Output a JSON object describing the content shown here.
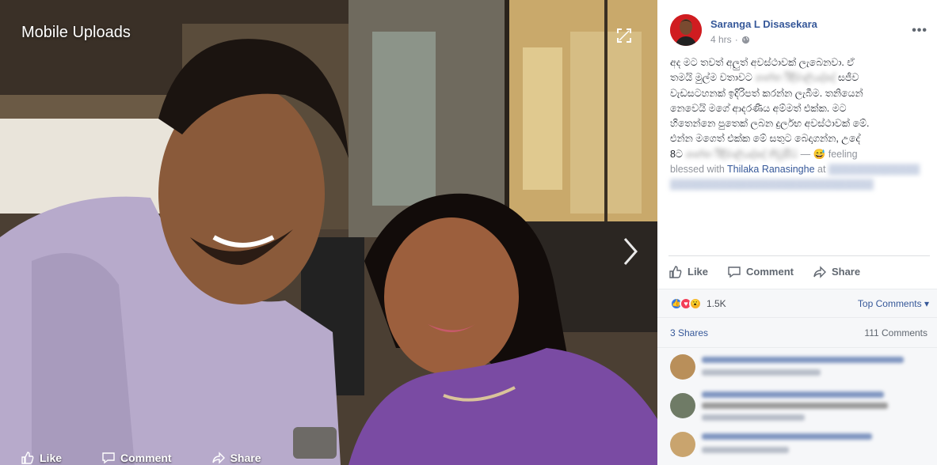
{
  "viewer": {
    "album_title": "Mobile Uploads",
    "actions": {
      "like": "Like",
      "comment": "Comment",
      "share": "Share"
    }
  },
  "post": {
    "author": "Saranga L Disasekara",
    "timestamp": "4 hrs",
    "text_lines": [
      "අද මට තවත් අලුත් අවස්ථාවක් ලැබෙනවා. ඒ",
      "තමයි මුල්ම වතාවට",
      "වැඩසටහනක් ඉදිරිපත් කරන්න ලැබීම. තනියෙන්",
      "නෙවෙයි මගේ ආදරණීය අම්මත් එක්ක. මට",
      "හිතෙන්නෙ පුතෙක් ලබන දුර්ලභ අවස්ථාවක් මේ.",
      "එන්න මගෙත් එක්ක මේ සතුට බෙදාගන්න, උදේ",
      "8ට"
    ],
    "line2_end": "සජීව",
    "feeling_label": "feeling",
    "blessed_with": "blessed with",
    "tagged_person": "Thilaka Ranasinghe",
    "at": "at"
  },
  "actions": {
    "like": "Like",
    "comment": "Comment",
    "share": "Share"
  },
  "reactions": {
    "count": "1.5K",
    "top_comments": "Top Comments"
  },
  "stats": {
    "shares": "3 Shares",
    "comments": "111 Comments"
  },
  "colors": {
    "link": "#365899",
    "panel_bg": "#ffffff",
    "stats_bg": "#f6f7f9",
    "like_blue": "#3578e5",
    "love_red": "#f33e58",
    "wow_yellow": "#f7b125"
  },
  "icons": [
    "expand-icon",
    "next-arrow-icon",
    "like-icon",
    "comment-icon",
    "share-icon",
    "globe-icon",
    "more-options-icon"
  ]
}
